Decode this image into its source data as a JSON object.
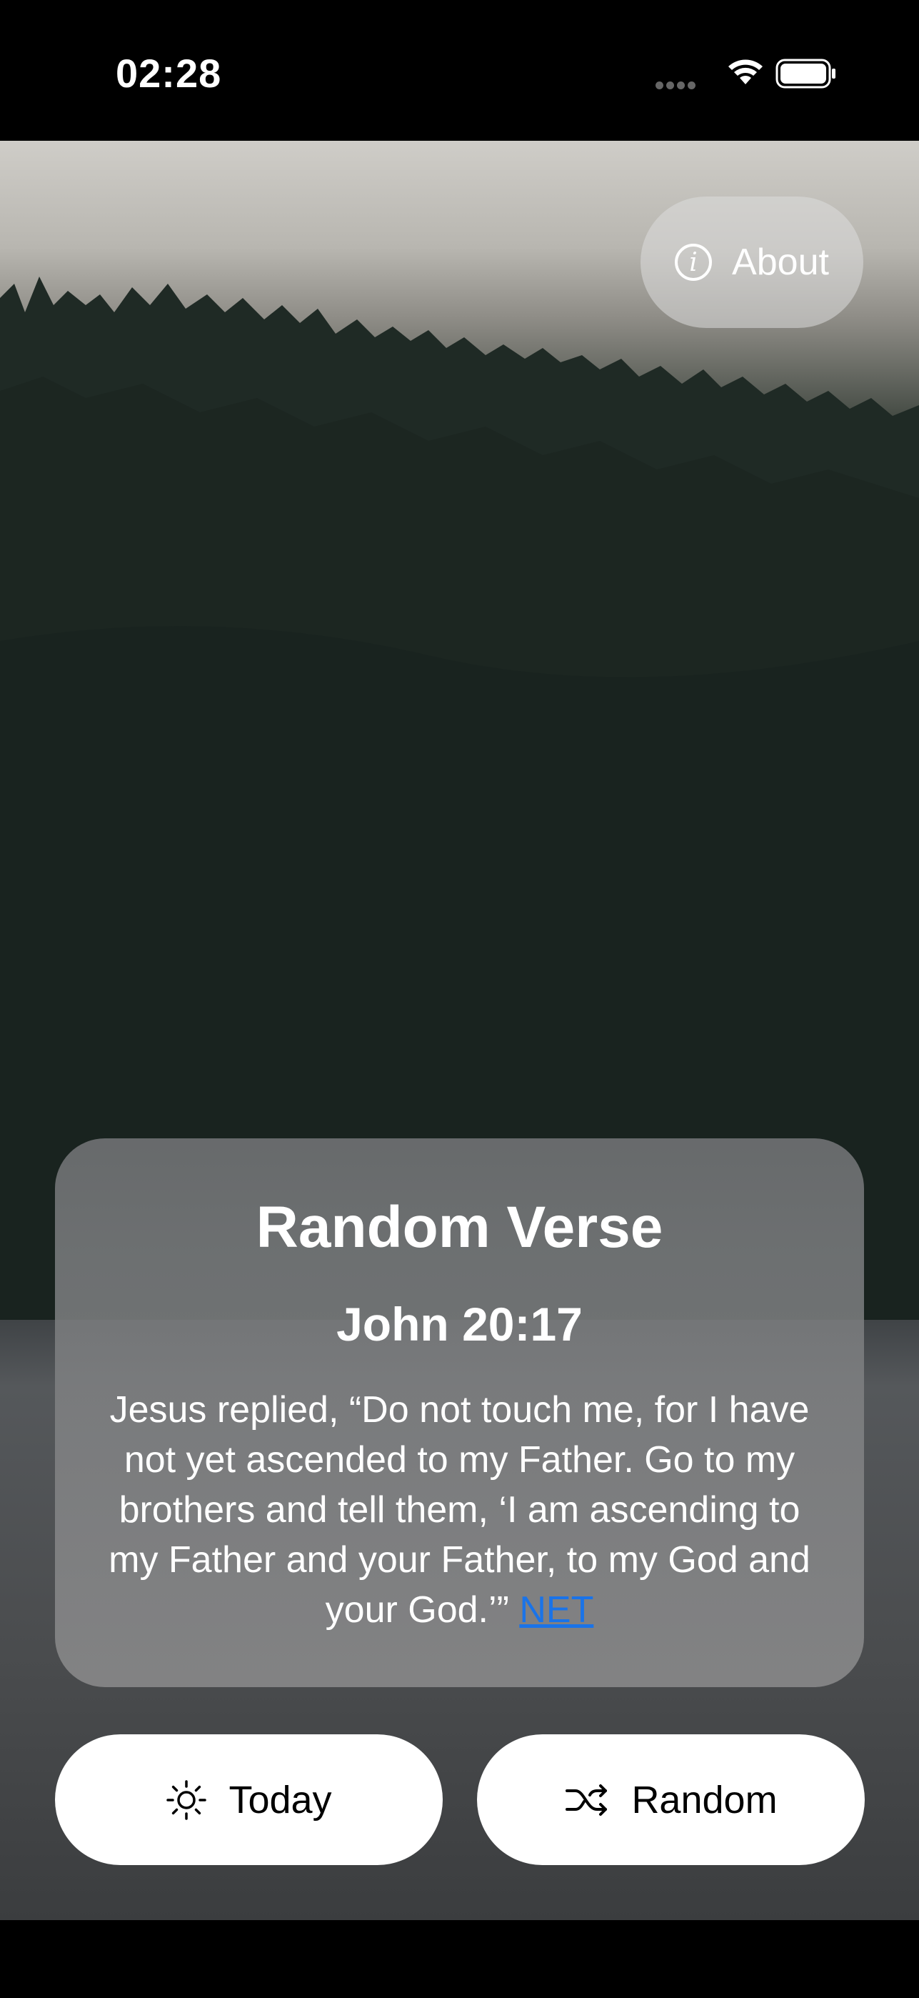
{
  "status_bar": {
    "time": "02:28"
  },
  "about_button": {
    "label": "About",
    "icon": "info-icon"
  },
  "card": {
    "title": "Random Verse",
    "reference": "John 20:17",
    "verse": "Jesus replied, “Do not touch me, for I have not yet ascended to my Father. Go to my brothers and tell them, ‘I am ascending to my Father and your Father, to my God and your God.’”",
    "translation": "NET",
    "translation_color": "#1a73e8"
  },
  "buttons": {
    "today": {
      "label": "Today",
      "icon": "sun-icon"
    },
    "random": {
      "label": "Random",
      "icon": "shuffle-icon"
    }
  }
}
